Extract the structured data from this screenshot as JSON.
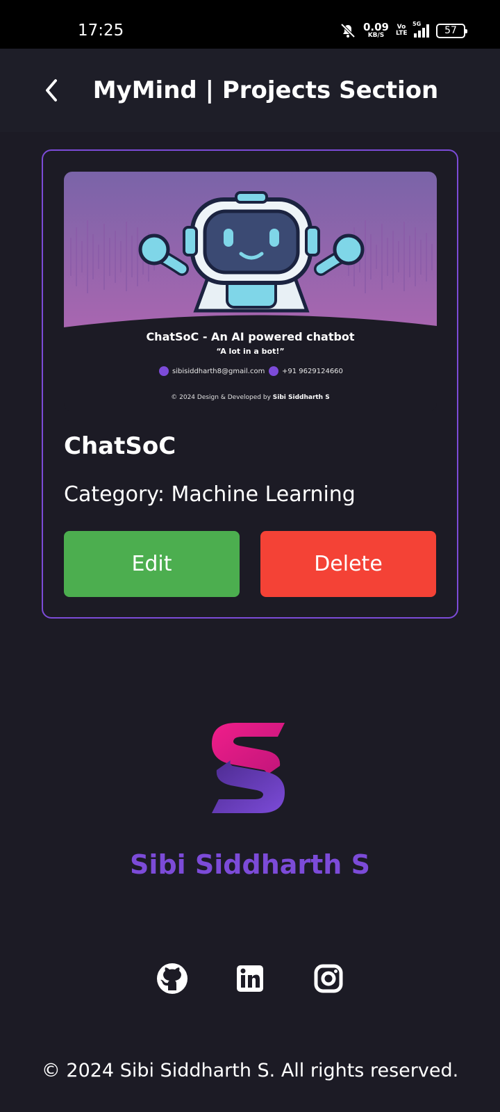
{
  "status_bar": {
    "time": "17:25",
    "net_speed": "0.09",
    "net_unit": "KB/S",
    "volte": "Vo LTE",
    "network": "5G",
    "battery": "57"
  },
  "header": {
    "title": "MyMind | Projects Section",
    "back_icon": "chevron-left-icon"
  },
  "project": {
    "banner": {
      "title": "ChatSoC - An AI powered chatbot",
      "tagline": "“A lot in a bot!”",
      "email": "sibisiddharth8@gmail.com",
      "phone": "+91 9629124660",
      "copyright_prefix": "© 2024 Design  & Developed by",
      "copyright_author": "Sibi Siddharth S"
    },
    "name": "ChatSoC",
    "category": "Category: Machine Learning",
    "edit_label": "Edit",
    "delete_label": "Delete"
  },
  "brand": {
    "name": "Sibi Siddharth S",
    "accent_color": "#7c4bd8",
    "logo_icon": "s-logo-icon"
  },
  "social": {
    "icons": [
      "github-icon",
      "linkedin-icon",
      "instagram-icon"
    ]
  },
  "footer": {
    "copyright": "© 2024 Sibi Siddharth S. All rights reserved."
  },
  "colors": {
    "background": "#1c1b25",
    "header_bg": "#1e1e28",
    "card_border": "#7c4bd8",
    "edit_button": "#4cae4f",
    "delete_button": "#f44236"
  }
}
